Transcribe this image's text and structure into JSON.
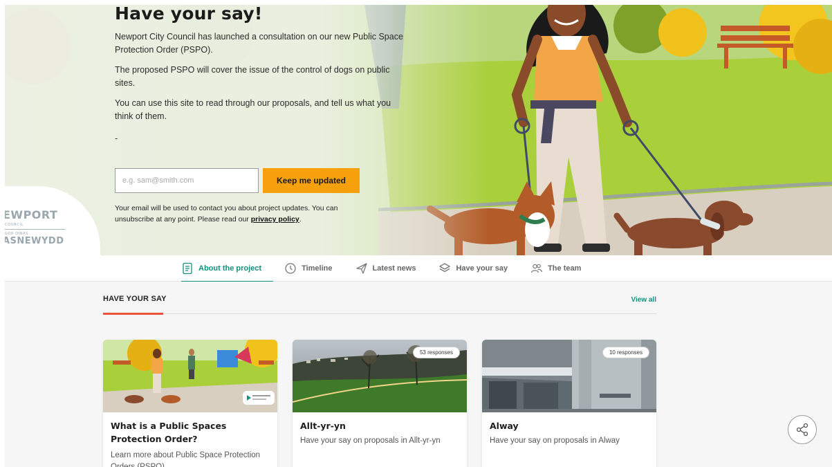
{
  "hero": {
    "title": "Have your say!",
    "paragraphs": [
      "Newport City Council has launched a consultation on our new Public Space Protection Order (PSPO).",
      "The proposed PSPO will cover the issue of the control of dogs on public sites.",
      "You can use this site to read through our proposals, and tell us what you think of them."
    ],
    "dash": "-",
    "email_placeholder": "e.g. sam@smith.com",
    "button_label": "Keep me updated",
    "note_text": "Your email will be used to contact you about project updates. You can unsubscribe at any point. Please read our ",
    "privacy_link": "privacy policy",
    "note_end": ".",
    "logo": {
      "line1": "EWPORT",
      "line2": "COUNCIL",
      "line3": "GOR DINAS",
      "line4": "ASNEWYDD"
    }
  },
  "nav": {
    "items": [
      {
        "label": "About the project",
        "icon": "document-icon",
        "active": true
      },
      {
        "label": "Timeline",
        "icon": "clock-icon",
        "active": false
      },
      {
        "label": "Latest news",
        "icon": "paper-plane-icon",
        "active": false
      },
      {
        "label": "Have your say",
        "icon": "layers-icon",
        "active": false
      },
      {
        "label": "The team",
        "icon": "people-icon",
        "active": false
      }
    ]
  },
  "section": {
    "title": "HAVE YOUR SAY",
    "view_all": "View all"
  },
  "cards": [
    {
      "title": "What is a Public Spaces Protection Order?",
      "desc": "Learn more about Public Space Protection Orders (PSPO).",
      "badge": ""
    },
    {
      "title": "Allt-yr-yn",
      "desc": "Have your say on proposals in Allt-yr-yn",
      "badge": "53 responses"
    },
    {
      "title": "Alway",
      "desc": "Have your say on proposals in Alway",
      "badge": "10 responses"
    }
  ],
  "colors": {
    "accent": "#148f7f",
    "button": "#f6a10b",
    "underline": "#e8533a"
  },
  "share_icon": "share-icon"
}
